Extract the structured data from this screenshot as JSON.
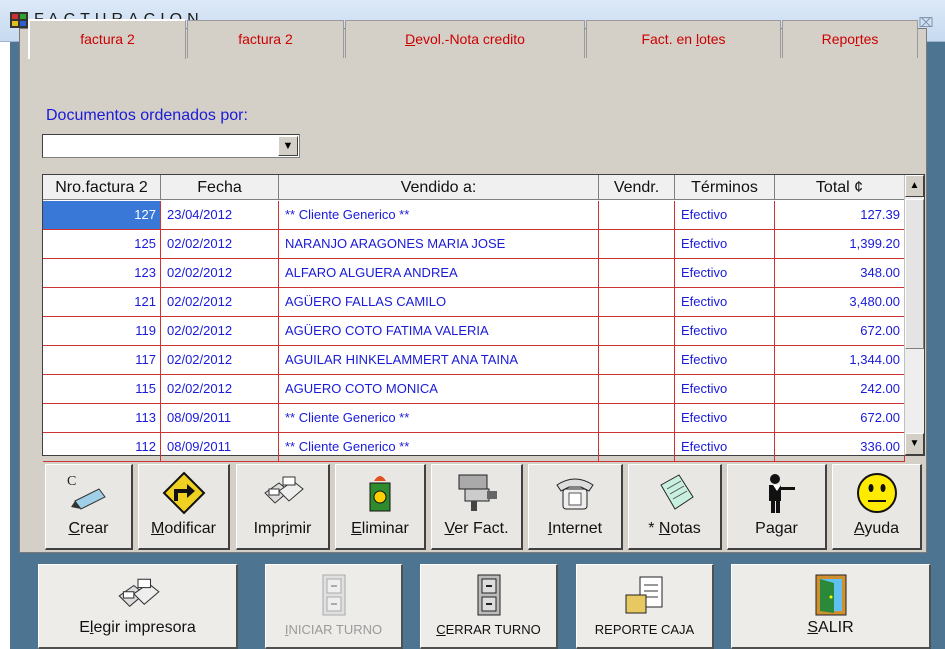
{
  "window": {
    "title": "FACTURACION",
    "close_glyph": "⌧"
  },
  "tabs": [
    {
      "label": "factura 2",
      "active": true
    },
    {
      "label": "factura 2",
      "active": false
    },
    {
      "label_pre": "",
      "label_u": "D",
      "label_post": "evol.-Nota credito"
    },
    {
      "label_pre": "Fact. en ",
      "label_u": "l",
      "label_post": "otes"
    },
    {
      "label_pre": "Repo",
      "label_u": "r",
      "label_post": "tes"
    }
  ],
  "sort": {
    "label": "Documentos ordenados por:",
    "value": "",
    "arrow": "▼"
  },
  "grid": {
    "headers": [
      "Nro.factura 2",
      "Fecha",
      "Vendido a:",
      "Vendr.",
      "Términos",
      "Total  ¢"
    ],
    "rows": [
      {
        "nro": "127",
        "fecha": "23/04/2012",
        "vendido": "** Cliente Generico **",
        "vendr": "",
        "terminos": "Efectivo",
        "total": "127.39"
      },
      {
        "nro": "125",
        "fecha": "02/02/2012",
        "vendido": "NARANJO ARAGONES MARIA JOSE",
        "vendr": "",
        "terminos": "Efectivo",
        "total": "1,399.20"
      },
      {
        "nro": "123",
        "fecha": "02/02/2012",
        "vendido": "ALFARO ALGUERA ANDREA",
        "vendr": "",
        "terminos": "Efectivo",
        "total": "348.00"
      },
      {
        "nro": "121",
        "fecha": "02/02/2012",
        "vendido": "AGÜERO FALLAS CAMILO",
        "vendr": "",
        "terminos": "Efectivo",
        "total": "3,480.00"
      },
      {
        "nro": "119",
        "fecha": "02/02/2012",
        "vendido": "AGÜERO COTO FATIMA VALERIA",
        "vendr": "",
        "terminos": "Efectivo",
        "total": "672.00"
      },
      {
        "nro": "117",
        "fecha": "02/02/2012",
        "vendido": "AGUILAR HINKELAMMERT ANA TAINA",
        "vendr": "",
        "terminos": "Efectivo",
        "total": "1,344.00"
      },
      {
        "nro": "115",
        "fecha": "02/02/2012",
        "vendido": "AGUERO COTO MONICA",
        "vendr": "",
        "terminos": "Efectivo",
        "total": "242.00"
      },
      {
        "nro": "113",
        "fecha": "08/09/2011",
        "vendido": "** Cliente Generico **",
        "vendr": "",
        "terminos": "Efectivo",
        "total": "672.00"
      },
      {
        "nro": "112",
        "fecha": "08/09/2011",
        "vendido": "** Cliente Generico **",
        "vendr": "",
        "terminos": "Efectivo",
        "total": "336.00"
      }
    ],
    "scroll_up": "▲",
    "scroll_down": "▼"
  },
  "toolbar": [
    {
      "u": "C",
      "rest": "rear",
      "pre": "",
      "icon": "pen-icon"
    },
    {
      "u": "M",
      "rest": "odificar",
      "pre": "",
      "icon": "arrow-sign-icon"
    },
    {
      "pre": "Impr",
      "u": "i",
      "rest": "mir",
      "icon": "printer-icon"
    },
    {
      "u": "E",
      "rest": "liminar",
      "pre": "",
      "icon": "trash-icon"
    },
    {
      "u": "V",
      "rest": "er Fact.",
      "pre": "",
      "icon": "camera-icon"
    },
    {
      "pre": "",
      "u": "I",
      "rest": "nternet",
      "icon": "telephone-icon"
    },
    {
      "pre": "* ",
      "u": "N",
      "rest": "otas",
      "icon": "notepad-icon"
    },
    {
      "pre": "Pa",
      "u": "g",
      "rest": "ar",
      "icon": "waiter-icon"
    },
    {
      "u": "A",
      "rest": "yuda",
      "pre": "",
      "icon": "smiley-icon"
    }
  ],
  "bottom": [
    {
      "pre": "E",
      "u": "l",
      "rest": "egir impresora",
      "icon": "printer-icon",
      "disabled": false
    },
    {
      "pre": "",
      "u": "I",
      "rest": "NICIAR TURNO",
      "icon": "cabinet-icon",
      "disabled": true
    },
    {
      "pre": "",
      "u": "C",
      "rest": "ERRAR TURNO",
      "icon": "cabinet-icon",
      "disabled": false
    },
    {
      "pre": "REPORTE CAJA",
      "u": "",
      "rest": "",
      "icon": "report-icon",
      "disabled": false
    },
    {
      "pre": "",
      "u": "S",
      "rest": "ALIR",
      "icon": "door-exit-icon",
      "disabled": false
    }
  ]
}
